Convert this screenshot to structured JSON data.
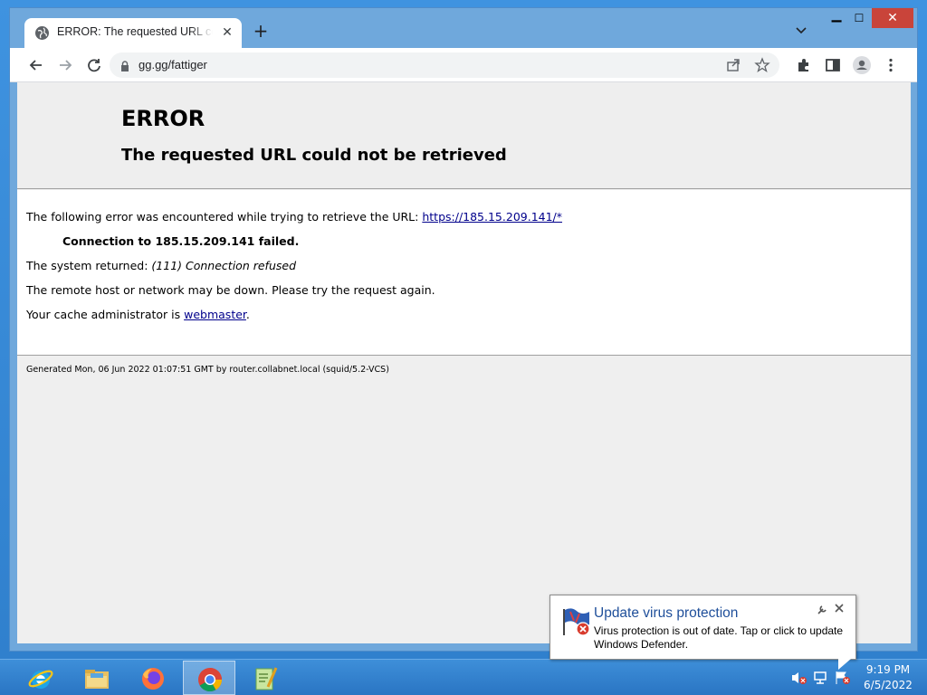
{
  "browser": {
    "tab": {
      "title": "ERROR: The requested URL could not be retrieved",
      "close_glyph": "✕",
      "favicon": "globe-icon"
    },
    "newtab_glyph": "+",
    "window_controls": {
      "minimize": "▁",
      "maximize": "☐",
      "close": "✕"
    },
    "toolbar": {
      "url": "gg.gg/fattiger",
      "back_icon": "back-arrow-icon",
      "forward_icon": "forward-arrow-icon",
      "reload_icon": "reload-icon",
      "share_icon": "share-icon",
      "bookmark_icon": "star-icon",
      "extensions_icon": "puzzle-icon",
      "sidepanel_icon": "sidepanel-icon",
      "profile_icon": "profile-icon",
      "menu_icon": "kebab-menu-icon"
    }
  },
  "page": {
    "title": "ERROR",
    "subtitle": "The requested URL could not be retrieved",
    "line1_prefix": "The following error was encountered while trying to retrieve the URL: ",
    "line1_link": "https://185.15.209.141/*",
    "line2": "Connection to 185.15.209.141 failed.",
    "line3_prefix": "The system returned: ",
    "line3_em": "(111) Connection refused",
    "line4": "The remote host or network may be down. Please try the request again.",
    "line5_prefix": "Your cache administrator is ",
    "line5_link": "webmaster",
    "line5_suffix": ".",
    "footer": "Generated Mon, 06 Jun 2022 01:07:51 GMT by router.collabnet.local (squid/5.2-VCS)"
  },
  "notification": {
    "title": "Update virus protection",
    "message": "Virus protection is out of date. Tap or click to update Windows Defender.",
    "icon": "defender-warning-icon"
  },
  "taskbar": {
    "apps": [
      {
        "name": "internet-explorer"
      },
      {
        "name": "file-explorer"
      },
      {
        "name": "firefox"
      },
      {
        "name": "chrome",
        "active": true
      },
      {
        "name": "notepad-plus"
      }
    ],
    "clock": {
      "time": "9:19 PM",
      "date": "6/5/2022"
    }
  },
  "colors": {
    "titlebar": "#6fa8dc",
    "close_button": "#c9443a",
    "link": "#00008b",
    "balloon_title": "#1f4f9a",
    "taskbar": "#2a75c3"
  }
}
